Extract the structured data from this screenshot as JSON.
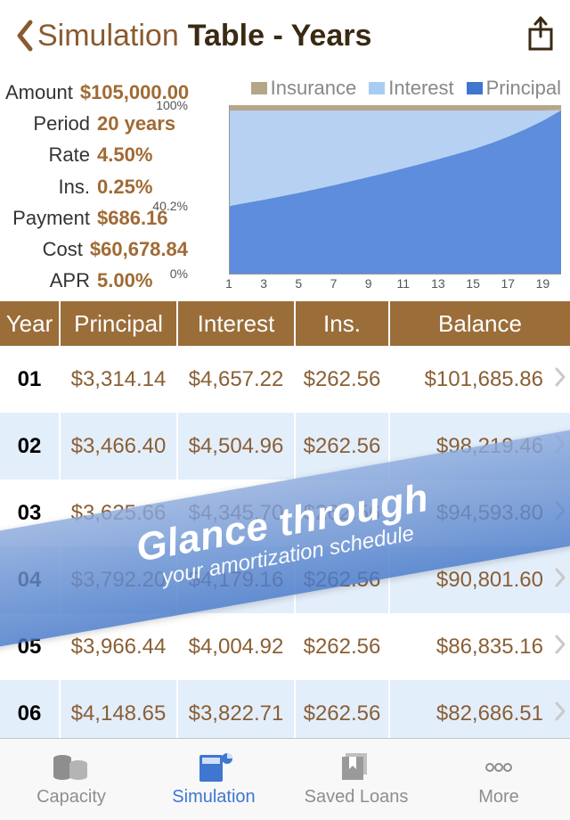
{
  "nav": {
    "back": "Simulation",
    "title": "Table - Years"
  },
  "summary": {
    "amount": {
      "label": "Amount",
      "value": "$105,000.00"
    },
    "period": {
      "label": "Period",
      "value": "20 years"
    },
    "rate": {
      "label": "Rate",
      "value": "4.50%"
    },
    "ins": {
      "label": "Ins.",
      "value": "0.25%"
    },
    "payment": {
      "label": "Payment",
      "value": "$686.16"
    },
    "cost": {
      "label": "Cost",
      "value": "$60,678.84"
    },
    "apr": {
      "label": "APR",
      "value": "5.00%"
    }
  },
  "legend": {
    "insurance": "Insurance",
    "interest": "Interest",
    "principal": "Principal"
  },
  "chart_data": {
    "type": "area",
    "title": "",
    "xlabel": "",
    "ylabel": "",
    "ylim": [
      0,
      100
    ],
    "x": [
      1,
      2,
      3,
      4,
      5,
      6,
      7,
      8,
      9,
      10,
      11,
      12,
      13,
      14,
      15,
      16,
      17,
      18,
      19,
      20
    ],
    "x_ticks": [
      1,
      3,
      5,
      7,
      9,
      11,
      13,
      15,
      17,
      19
    ],
    "y_ticks": [
      0,
      40.2,
      100
    ],
    "y_tick_labels": [
      "0%",
      "40.2%",
      "100%"
    ],
    "series": [
      {
        "name": "Principal",
        "values": [
          40.2,
          42.1,
          44.0,
          46.0,
          48.1,
          50.3,
          52.6,
          55.0,
          57.5,
          60.0,
          62.6,
          65.3,
          68.1,
          71.0,
          74.0,
          77.5,
          81.5,
          86.0,
          91.0,
          97.0
        ]
      },
      {
        "name": "Interest",
        "values": [
          56.6,
          54.7,
          52.8,
          50.8,
          48.7,
          46.5,
          44.2,
          41.8,
          39.3,
          36.8,
          34.2,
          31.5,
          28.7,
          25.8,
          22.8,
          19.3,
          15.3,
          10.8,
          5.8,
          0.0
        ]
      },
      {
        "name": "Insurance",
        "values": [
          3.2,
          3.2,
          3.2,
          3.2,
          3.2,
          3.2,
          3.2,
          3.2,
          3.2,
          3.2,
          3.2,
          3.2,
          3.2,
          3.2,
          3.2,
          3.2,
          3.2,
          3.2,
          3.2,
          3.0
        ]
      }
    ]
  },
  "table": {
    "headers": {
      "year": "Year",
      "principal": "Principal",
      "interest": "Interest",
      "ins": "Ins.",
      "balance": "Balance"
    },
    "rows": [
      {
        "year": "01",
        "principal": "$3,314.14",
        "interest": "$4,657.22",
        "ins": "$262.56",
        "balance": "$101,685.86"
      },
      {
        "year": "02",
        "principal": "$3,466.40",
        "interest": "$4,504.96",
        "ins": "$262.56",
        "balance": "$98,219.46"
      },
      {
        "year": "03",
        "principal": "$3,625.66",
        "interest": "$4,345.70",
        "ins": "$262.56",
        "balance": "$94,593.80"
      },
      {
        "year": "04",
        "principal": "$3,792.20",
        "interest": "$4,179.16",
        "ins": "$262.56",
        "balance": "$90,801.60"
      },
      {
        "year": "05",
        "principal": "$3,966.44",
        "interest": "$4,004.92",
        "ins": "$262.56",
        "balance": "$86,835.16"
      },
      {
        "year": "06",
        "principal": "$4,148.65",
        "interest": "$3,822.71",
        "ins": "$262.56",
        "balance": "$82,686.51"
      }
    ]
  },
  "banner": {
    "line1": "Glance through",
    "line2": "your amortization schedule"
  },
  "tabs": {
    "capacity": "Capacity",
    "simulation": "Simulation",
    "saved": "Saved Loans",
    "more": "More"
  }
}
